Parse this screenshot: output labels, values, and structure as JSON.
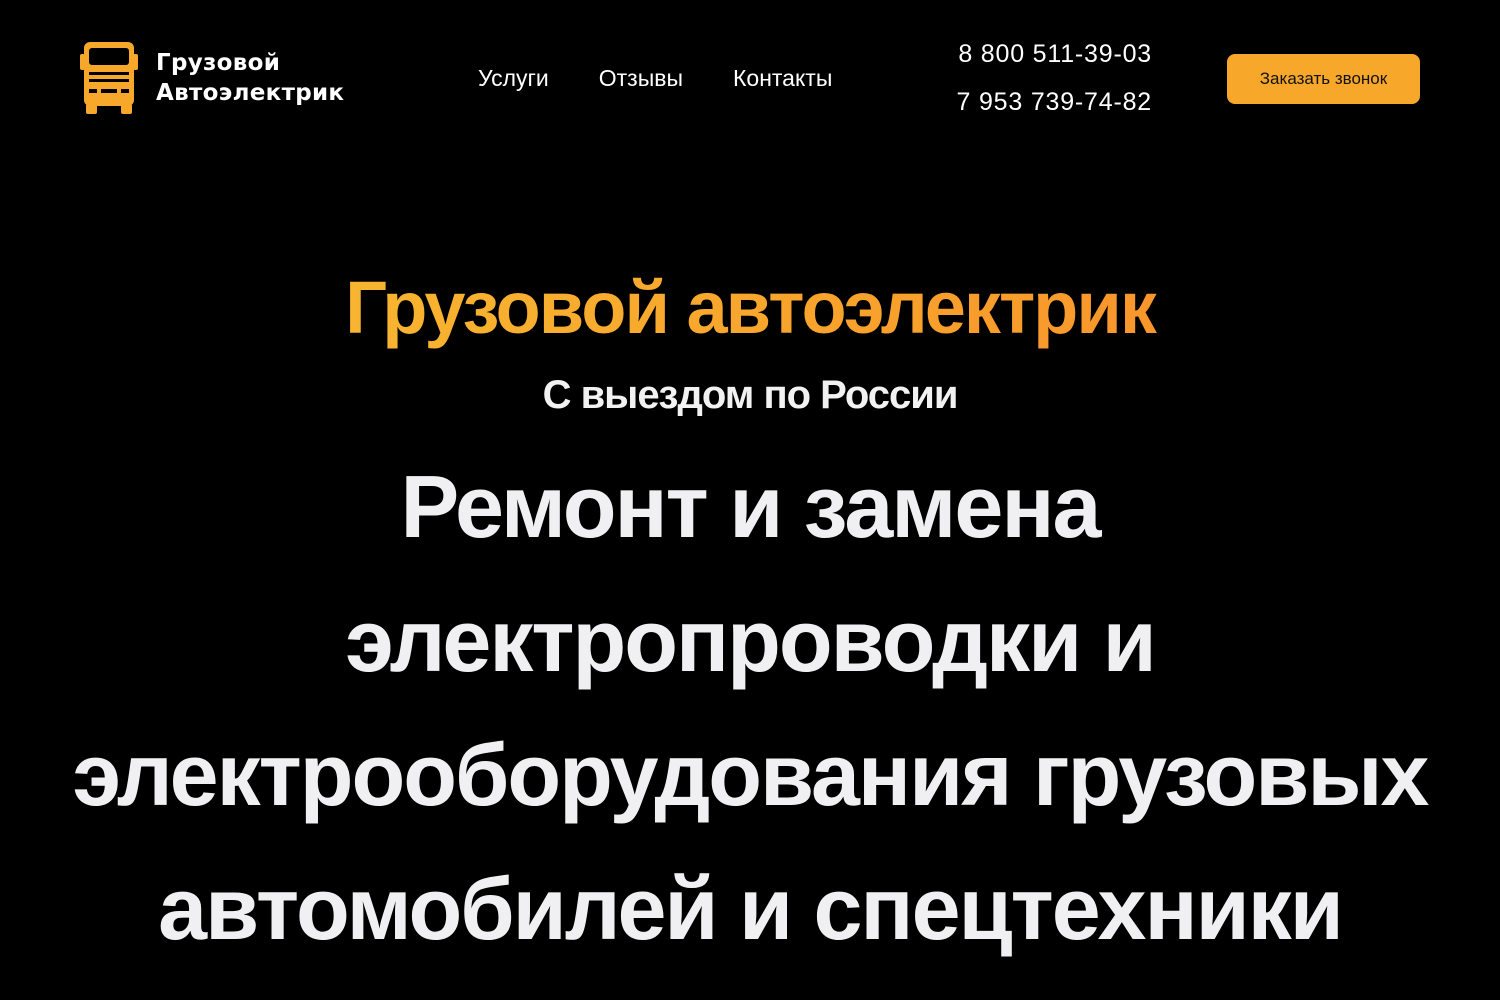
{
  "header": {
    "logo": {
      "icon": "truck-icon",
      "line1": "Грузовой",
      "line2": "Автоэлектрик"
    },
    "nav": [
      {
        "label": "Услуги"
      },
      {
        "label": "Отзывы"
      },
      {
        "label": "Контакты"
      }
    ],
    "phones": [
      "8 800 511-39-03",
      "7 953 739-74-82"
    ],
    "callback_button": "Заказать звонок"
  },
  "hero": {
    "title": "Грузовой автоэлектрик",
    "subtitle": "С выездом по России",
    "heading_lines": [
      "Ремонт и замена",
      "электропроводки и",
      "электрооборудования грузовых",
      "автомобилей и спецтехники"
    ]
  },
  "colors": {
    "background": "#000000",
    "accent": "#f7a82a",
    "accent_gradient_start": "#f8c233",
    "accent_gradient_end": "#f7892b",
    "text": "#ffffff"
  }
}
